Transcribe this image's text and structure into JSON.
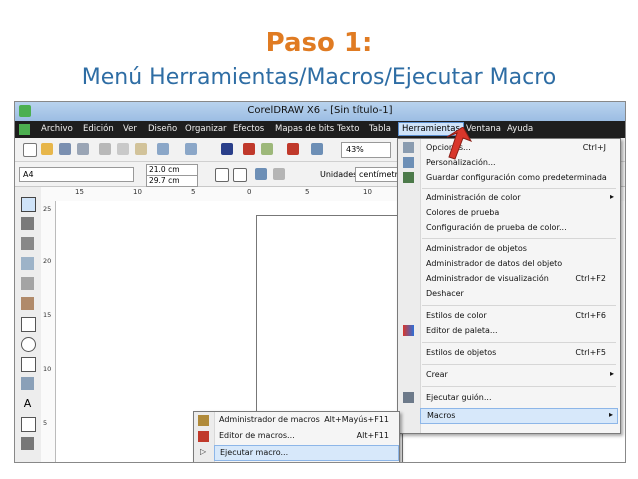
{
  "slide": {
    "title": "Paso 1:",
    "subtitle": "Menú Herramientas/Macros/Ejecutar Macro"
  },
  "app": {
    "title": "CorelDRAW X6 - [Sin título-1]"
  },
  "menubar": {
    "items": [
      "Archivo",
      "Edición",
      "Ver",
      "Diseño",
      "Organizar",
      "Efectos",
      "Mapas de bits",
      "Texto",
      "Tabla",
      "Herramientas",
      "Ventana",
      "Ayuda"
    ],
    "active_index": 9
  },
  "toolbar": {
    "zoom": "43%"
  },
  "property_bar": {
    "page_size": "A4",
    "width": "21.0 cm",
    "height": "29.7 cm",
    "units_label": "Unidades:",
    "units_value": "centímetros"
  },
  "ruler": {
    "h_labels": [
      "15",
      "10",
      "5",
      "0",
      "5",
      "10"
    ],
    "v_labels": [
      "25",
      "20",
      "15",
      "10",
      "5"
    ]
  },
  "tools_menu": {
    "items": [
      {
        "label": "Opciones...",
        "shortcut": "Ctrl+J"
      },
      {
        "label": "Personalización..."
      },
      {
        "label": "Guardar configuración como predeterminada"
      },
      {
        "label": "Administración de color",
        "submenu": true
      },
      {
        "label": "Colores de prueba"
      },
      {
        "label": "Configuración de prueba de color..."
      },
      {
        "label": "Administrador de objetos"
      },
      {
        "label": "Administrador de datos del objeto"
      },
      {
        "label": "Administrador de visualización",
        "shortcut": "Ctrl+F2"
      },
      {
        "label": "Deshacer"
      },
      {
        "label": "Estilos de color",
        "shortcut": "Ctrl+F6"
      },
      {
        "label": "Editor de paleta..."
      },
      {
        "label": "Estilos de objetos",
        "shortcut": "Ctrl+F5"
      },
      {
        "label": "Crear",
        "submenu": true
      },
      {
        "label": "Ejecutar guión..."
      },
      {
        "label": "Macros",
        "submenu": true
      }
    ]
  },
  "macros_menu": {
    "items": [
      {
        "label": "Administrador de macros",
        "shortcut": "Alt+Mayús+F11"
      },
      {
        "label": "Editor de macros...",
        "shortcut": "Alt+F11"
      },
      {
        "label": "Ejecutar macro..."
      }
    ]
  },
  "colors": {
    "title": "#e07b22",
    "subtitle": "#2e6da4",
    "highlight": "#d7e8fa",
    "pointer": "#d9362b"
  }
}
